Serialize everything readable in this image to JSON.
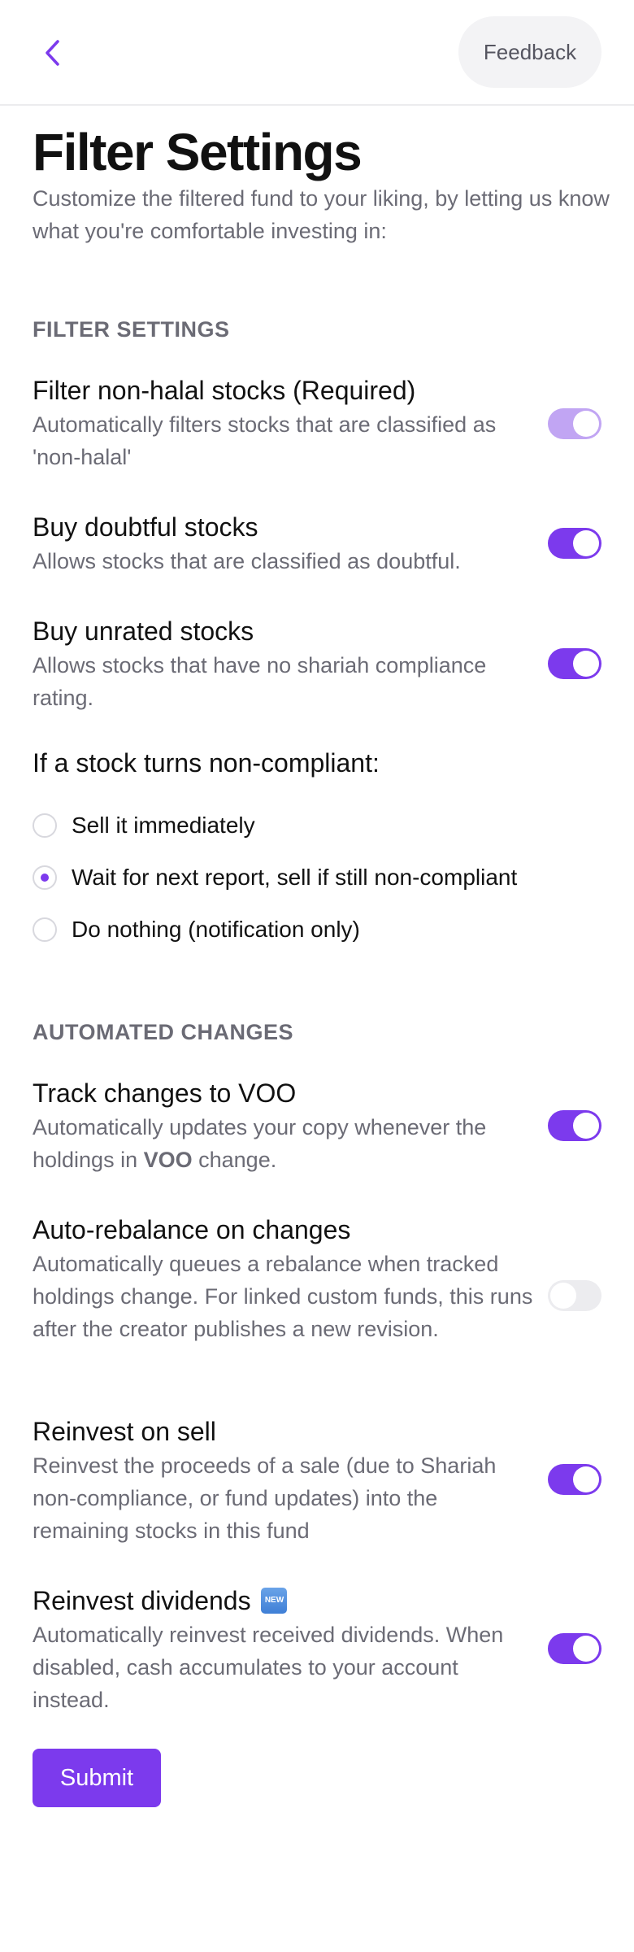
{
  "header": {
    "back_icon": "chevron-left-icon",
    "feedback_label": "Feedback"
  },
  "page": {
    "title": "Filter Settings",
    "subtitle": "Customize the filtered fund to your liking, by letting us know what you're comfortable investing in:"
  },
  "filter_section": {
    "heading": "FILTER SETTINGS",
    "settings": [
      {
        "title": "Filter non-halal stocks (Required)",
        "description": "Automatically filters stocks that are classified as 'non-halal'",
        "enabled": true,
        "disabled": true
      },
      {
        "title": "Buy doubtful stocks",
        "description": "Allows stocks that are classified as doubtful.",
        "enabled": true
      },
      {
        "title": "Buy unrated stocks",
        "description": "Allows stocks that have no shariah compliance rating.",
        "enabled": true
      }
    ],
    "non_compliant": {
      "question": "If a stock turns non-compliant:",
      "options": [
        {
          "label": "Sell it immediately",
          "selected": false
        },
        {
          "label": "Wait for next report, sell if still non-compliant",
          "selected": true
        },
        {
          "label": "Do nothing (notification only)",
          "selected": false
        }
      ]
    }
  },
  "automated_section": {
    "heading": "AUTOMATED CHANGES",
    "settings": [
      {
        "title": "Track changes to VOO",
        "description_pre": "Automatically updates your copy whenever the holdings in ",
        "description_bold": "VOO",
        "description_post": " change.",
        "enabled": true
      },
      {
        "title": "Auto-rebalance on changes",
        "description": "Automatically queues a rebalance when tracked holdings change. For linked custom funds, this runs after the creator publishes a new revision.",
        "enabled": false
      },
      {
        "title": "Reinvest on sell",
        "description": "Reinvest the proceeds of a sale (due to Shariah non-compliance, or fund updates) into the remaining stocks in this fund",
        "enabled": true
      },
      {
        "title": "Reinvest dividends",
        "badge": "NEW",
        "description": "Automatically reinvest received dividends. When disabled, cash accumulates to your account instead.",
        "enabled": true
      }
    ]
  },
  "submit_label": "Submit",
  "colors": {
    "accent": "#7c3aed",
    "accent_disabled": "#c1a5f3",
    "muted_text": "#6b6b75"
  }
}
